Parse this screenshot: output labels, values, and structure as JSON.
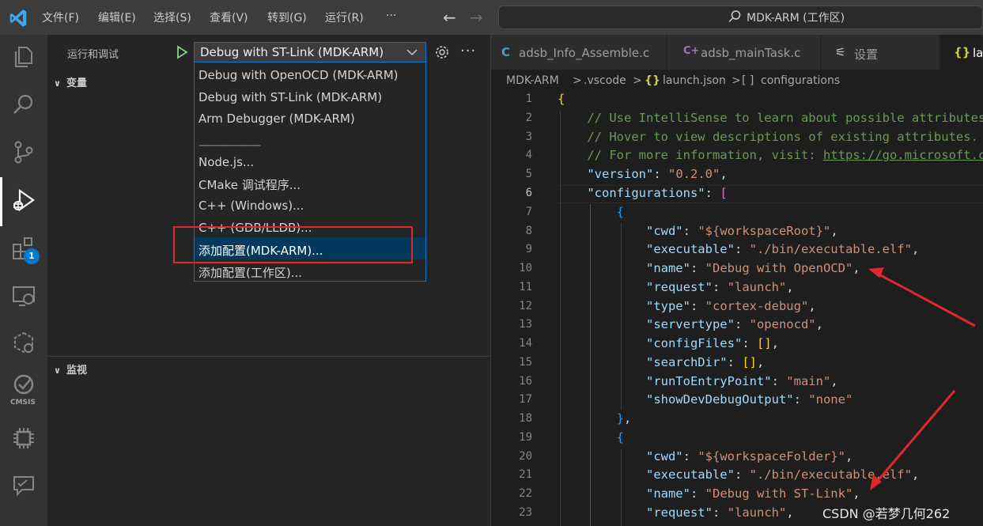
{
  "menu": [
    "文件(F)",
    "编辑(E)",
    "选择(S)",
    "查看(V)",
    "转到(G)",
    "运行(R)",
    "···"
  ],
  "command_center": {
    "title": "MDK-ARM (工作区)"
  },
  "activity_bar": {
    "items": [
      "explorer-icon",
      "search-icon",
      "source-control-icon",
      "run-debug-icon",
      "extensions-icon",
      "remote-explorer-icon",
      "settings-sync-icon",
      "cmsis-icon",
      "chip-icon",
      "feedback-icon"
    ],
    "extensions_badge": "1",
    "cmsis_label": "CMSIS"
  },
  "sidebar": {
    "title": "运行和调试",
    "selected_config": "Debug with ST-Link (MDK-ARM)",
    "sections": {
      "variables": "变量",
      "watch": "监视"
    }
  },
  "dropdown": {
    "items": [
      "Debug with OpenOCD (MDK-ARM)",
      "Debug with ST-Link (MDK-ARM)",
      "Arm Debugger (MDK-ARM)",
      "——————",
      "Node.js...",
      "CMake 调试程序...",
      "C++ (Windows)...",
      "C++ (GDB/LLDB)...",
      "添加配置(MDK-ARM)...",
      "添加配置(工作区)..."
    ],
    "highlighted_index": 8
  },
  "tabs": [
    {
      "icon": "C",
      "label": "adsb_Info_Assemble.c",
      "icon_color": "#519aba"
    },
    {
      "icon": "C+",
      "label": "adsb_mainTask.c",
      "icon_color": "#a074c4"
    },
    {
      "icon": "⚟",
      "label": "设置",
      "icon_color": "#cccccc"
    },
    {
      "icon": "{}",
      "label": "laun",
      "icon_color": "#cbcb41"
    }
  ],
  "breadcrumb": [
    "MDK-ARM",
    ">",
    ".vscode",
    ">",
    "{}",
    "launch.json",
    ">",
    "[ ]",
    "configurations"
  ],
  "editor": {
    "active_line": 6,
    "line_numbers": [
      1,
      2,
      3,
      4,
      5,
      6,
      7,
      8,
      9,
      10,
      11,
      12,
      13,
      14,
      15,
      16,
      17,
      18,
      19,
      20,
      21,
      22,
      23
    ]
  },
  "colors": {
    "accent": "#0078d4",
    "annotation": "#e0272a"
  },
  "watermark": "CSDN @若梦几何262"
}
